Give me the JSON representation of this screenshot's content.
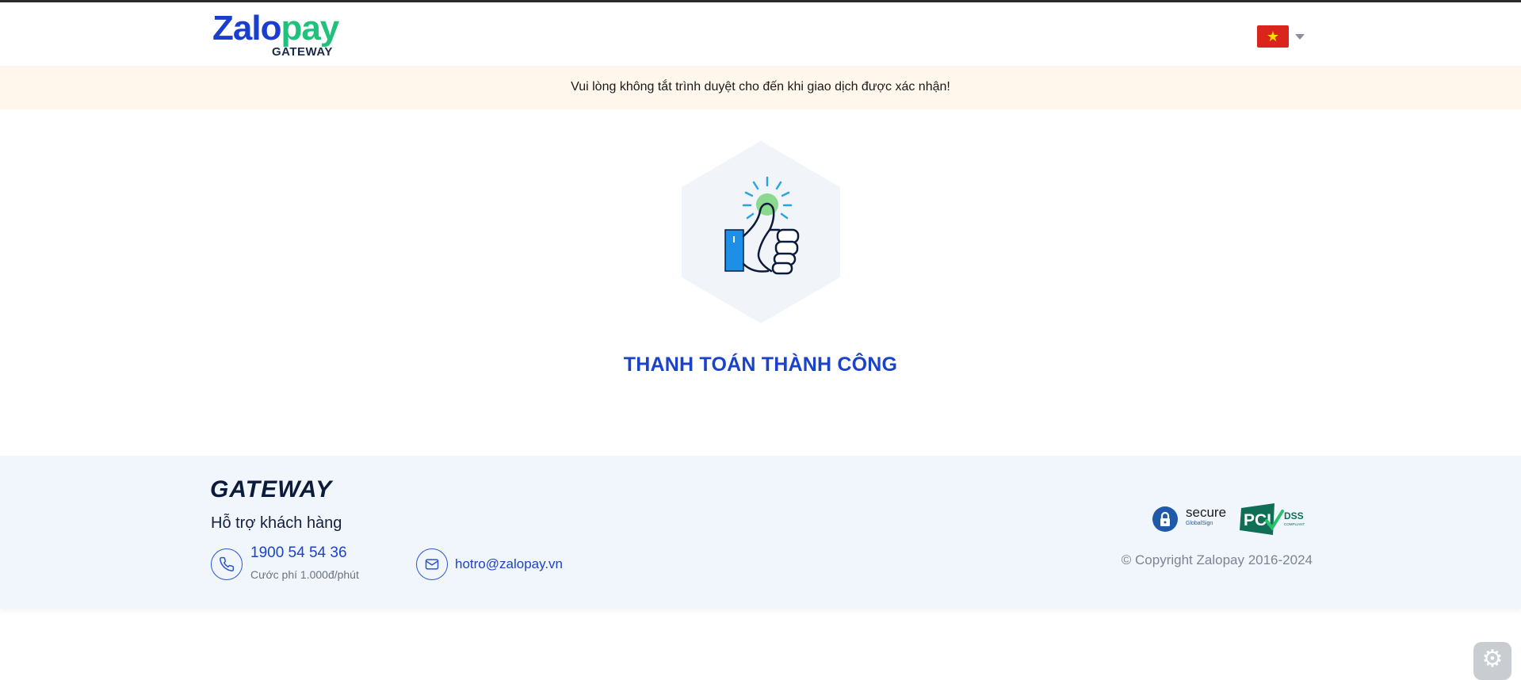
{
  "header": {
    "logo_main_part1": "Zalo",
    "logo_main_part2": "pay",
    "logo_sub": "GATEWAY",
    "language_flag": "★"
  },
  "banner": {
    "text": "Vui lòng không tắt trình duyệt cho đến khi giao dịch được xác nhận!"
  },
  "result": {
    "title": "THANH TOÁN THÀNH CÔNG",
    "icon": "thumbs-up-icon"
  },
  "footer": {
    "brand": "GATEWAY",
    "support_title": "Hỗ trợ khách hàng",
    "phone": "1900 54 54 36",
    "phone_fee": "Cước phí 1.000đ/phút",
    "email": "hotro@zalopay.vn",
    "badge_secure": "secure",
    "badge_globalsign": "GlobalSign",
    "badge_pci": "PCI",
    "badge_dss": "DSS",
    "badge_compliant": "COMPLIANT",
    "copyright": "© Copyright Zalopay 2016-2024"
  },
  "colors": {
    "brand_blue": "#1b43c9",
    "brand_green": "#1fc27a",
    "banner_bg": "#fff7ec",
    "footer_bg": "#f1f6fd"
  },
  "widgets": {
    "settings_glyph": "⚙"
  }
}
